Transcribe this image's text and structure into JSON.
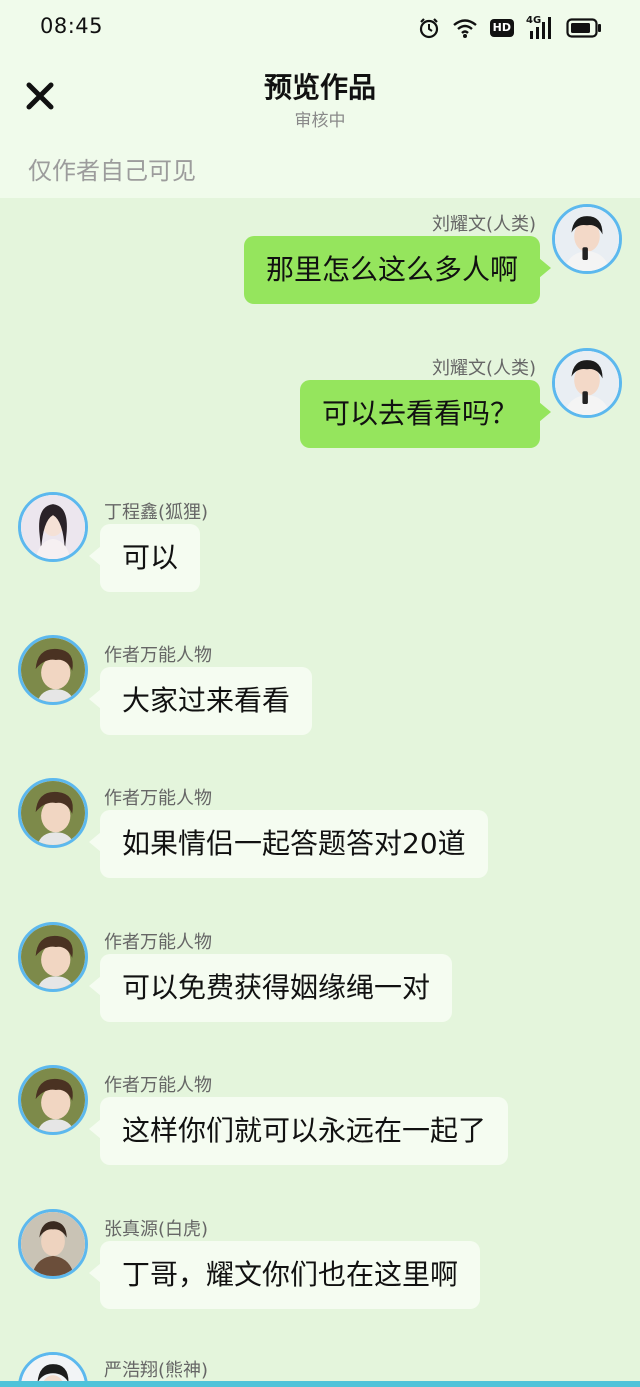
{
  "status_bar": {
    "time": "08:45",
    "icons": [
      "alarm-icon",
      "wifi-icon",
      "hd-icon",
      "4g-signal-icon",
      "battery-icon"
    ],
    "hd_label": "HD",
    "network_label": "4G"
  },
  "header": {
    "title": "预览作品",
    "subtitle": "审核中",
    "close_icon": "close-icon"
  },
  "visibility_note": "仅作者自己可见",
  "colors": {
    "chat_background": "#e4f5dc",
    "outgoing_bubble": "#95e55d",
    "incoming_bubble": "#f5fcf1",
    "avatar_border": "#5cb8ee"
  },
  "messages": [
    {
      "sender": "刘耀文(人类)",
      "text": "那里怎么这么多人啊",
      "side": "right"
    },
    {
      "sender": "刘耀文(人类)",
      "text": "可以去看看吗？",
      "side": "right"
    },
    {
      "sender": "丁程鑫(狐狸)",
      "text": "可以",
      "side": "left"
    },
    {
      "sender": "作者万能人物",
      "text": "大家过来看看",
      "side": "left"
    },
    {
      "sender": "作者万能人物",
      "text": "如果情侣一起答题答对20道",
      "side": "left"
    },
    {
      "sender": "作者万能人物",
      "text": "可以免费获得姻缘绳一对",
      "side": "left"
    },
    {
      "sender": "作者万能人物",
      "text": "这样你们就可以永远在一起了",
      "side": "left"
    },
    {
      "sender": "张真源(白虎)",
      "text": "丁哥，耀文你们也在这里啊",
      "side": "left"
    },
    {
      "sender": "严浩翔(熊神)",
      "text": "",
      "side": "left"
    }
  ]
}
